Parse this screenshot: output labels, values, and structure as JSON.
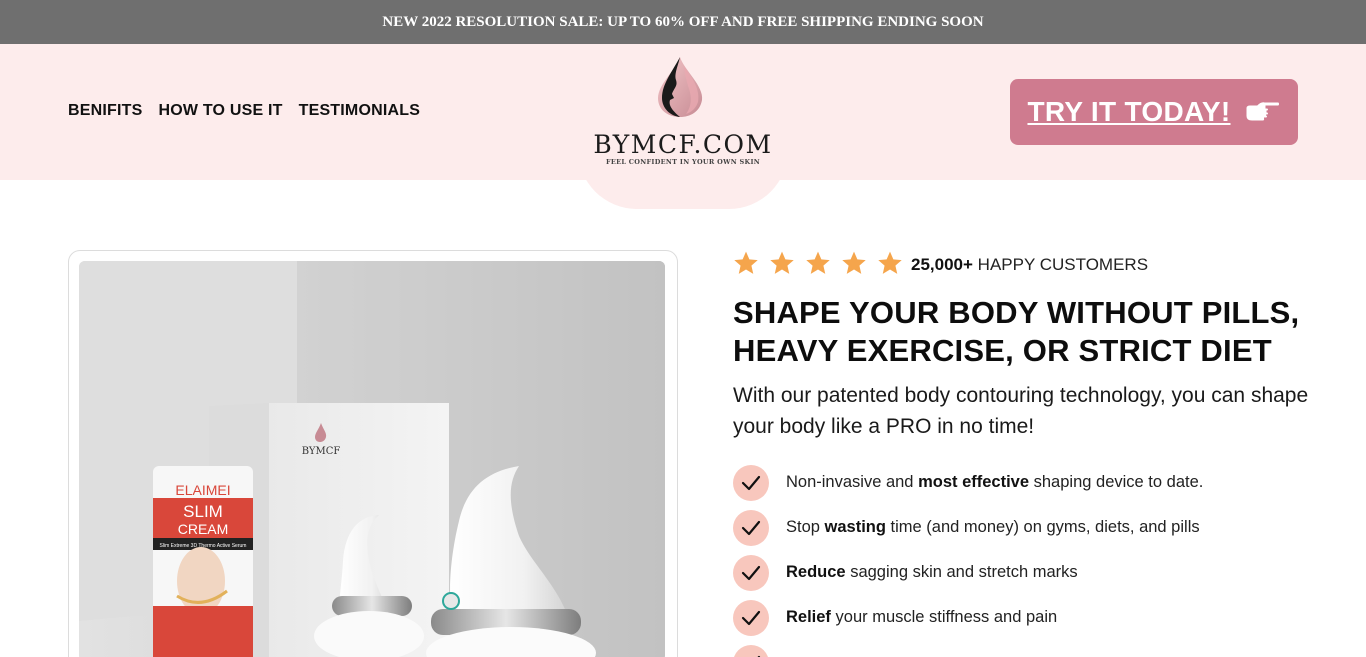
{
  "announcement": "NEW 2022 RESOLUTION SALE: UP TO 60% OFF AND FREE SHIPPING ENDING SOON",
  "nav": {
    "items": [
      {
        "label": "BENIFITS"
      },
      {
        "label": "HOW TO USE IT"
      },
      {
        "label": "TESTIMONIALS"
      }
    ]
  },
  "logo": {
    "name": "BYMCF.COM",
    "tagline": "FEEL CONFIDENT IN YOUR OWN SKIN"
  },
  "cta": {
    "label": "TRY IT TODAY!",
    "icon": "pointing-hand-icon"
  },
  "product_image": {
    "box_brand": "BYMCF",
    "tube_brand": "ELAIMEI",
    "tube_title_1": "SLIM",
    "tube_title_2": "CREAM",
    "tube_band": "Slim Extreme 3D Thermo Active Serum"
  },
  "rating": {
    "stars": 5,
    "count": "25,000+",
    "label": "HAPPY CUSTOMERS",
    "star_color": "#f5a54c"
  },
  "headline": {
    "line1": "SHAPE YOUR BODY WITHOUT PILLS,",
    "line2": "HEAVY EXERCISE, OR STRICT DIET"
  },
  "subhead": "With our patented body contouring technology, you can shape your body like a PRO in no time!",
  "benefits": [
    {
      "before": "Non-invasive and ",
      "bold": "most effective",
      "after": " shaping device to date."
    },
    {
      "before": "Stop ",
      "bold": "wasting",
      "after": " time (and money) on gyms, diets, and pills"
    },
    {
      "before": "",
      "bold": "Reduce",
      "after": " sagging skin and stretch marks"
    },
    {
      "before": "",
      "bold": "Relief",
      "after": " your muscle stiffness and pain"
    }
  ],
  "colors": {
    "announcement_bg": "#6f6f6f",
    "header_bg": "#fdecec",
    "cta_bg": "#cf7b8f",
    "check_bg": "#f8c7bd"
  }
}
